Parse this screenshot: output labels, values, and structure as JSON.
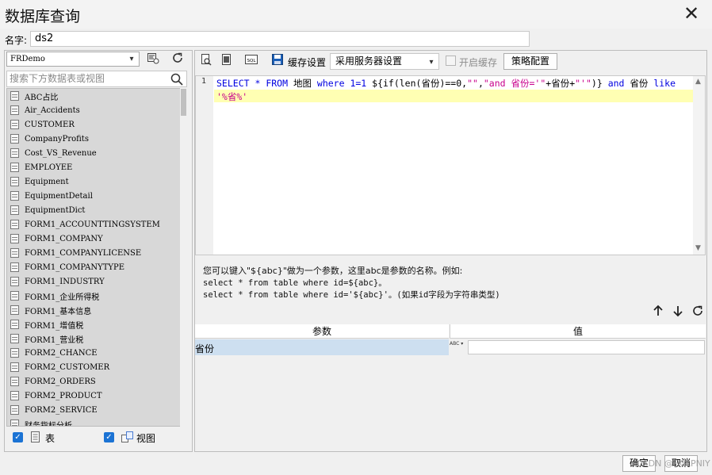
{
  "window": {
    "title": "数据库查询",
    "close_glyph": "✕"
  },
  "name_field": {
    "label": "名字:",
    "value": "ds2"
  },
  "left": {
    "db_select": "FRDemo",
    "search_placeholder": "搜索下方数据表或视图",
    "items": [
      "ABC占比",
      "Air_Accidents",
      "CUSTOMER",
      "CompanyProfits",
      "Cost_VS_Revenue",
      "EMPLOYEE",
      "Equipment",
      "EquipmentDetail",
      "EquipmentDict",
      "FORM1_ACCOUNTTINGSYSTEM",
      "FORM1_COMPANY",
      "FORM1_COMPANYLICENSE",
      "FORM1_COMPANYTYPE",
      "FORM1_INDUSTRY",
      "FORM1_企业所得税",
      "FORM1_基本信息",
      "FORM1_增值税",
      "FORM1_营业税",
      "FORM2_CHANCE",
      "FORM2_CUSTOMER",
      "FORM2_ORDERS",
      "FORM2_PRODUCT",
      "FORM2_SERVICE",
      "财务指标分析"
    ],
    "table_check_label": "表",
    "view_check_label": "视图",
    "check_glyph": "✓"
  },
  "toolbar": {
    "cache_label": "缓存设置",
    "cache_value": "采用服务器设置",
    "enable_cache_label": "开启缓存",
    "strategy_button": "策略配置",
    "sql_icon_text": "SQL"
  },
  "editor": {
    "line_number": "1",
    "tokens": [
      {
        "t": "SELECT",
        "c": "kw"
      },
      {
        "t": " * ",
        "c": "kw"
      },
      {
        "t": "FROM",
        "c": "kw"
      },
      {
        "t": " 地图 ",
        "c": ""
      },
      {
        "t": "where",
        "c": "kw"
      },
      {
        "t": " 1=1 ",
        "c": "kw"
      },
      {
        "t": "${if(len(省份)==0,",
        "c": ""
      },
      {
        "t": "\"\"",
        "c": "str"
      },
      {
        "t": ",",
        "c": ""
      },
      {
        "t": "\"and 省份='\"",
        "c": "str"
      },
      {
        "t": "+省份+",
        "c": ""
      },
      {
        "t": "\"'\"",
        "c": "str"
      },
      {
        "t": ")} ",
        "c": ""
      },
      {
        "t": "and",
        "c": "kw"
      },
      {
        "t": " 省份 ",
        "c": ""
      },
      {
        "t": "like",
        "c": "kw"
      }
    ],
    "wrap_text": "'%省%'"
  },
  "hint": {
    "line1": "您可以键入\"${abc}\"做为一个参数，这里abc是参数的名称。例如:",
    "line2": "select * from table where id=${abc}。",
    "line3": "select * from table where id='${abc}'。(如果id字段为字符串类型)"
  },
  "params": {
    "header_param": "参数",
    "header_value": "值",
    "rows": [
      {
        "name": "省份",
        "type_icon": "ABC"
      }
    ]
  },
  "footer": {
    "ok": "确定",
    "cancel": "取消",
    "watermark": "CSDN @HCLPNIY"
  }
}
